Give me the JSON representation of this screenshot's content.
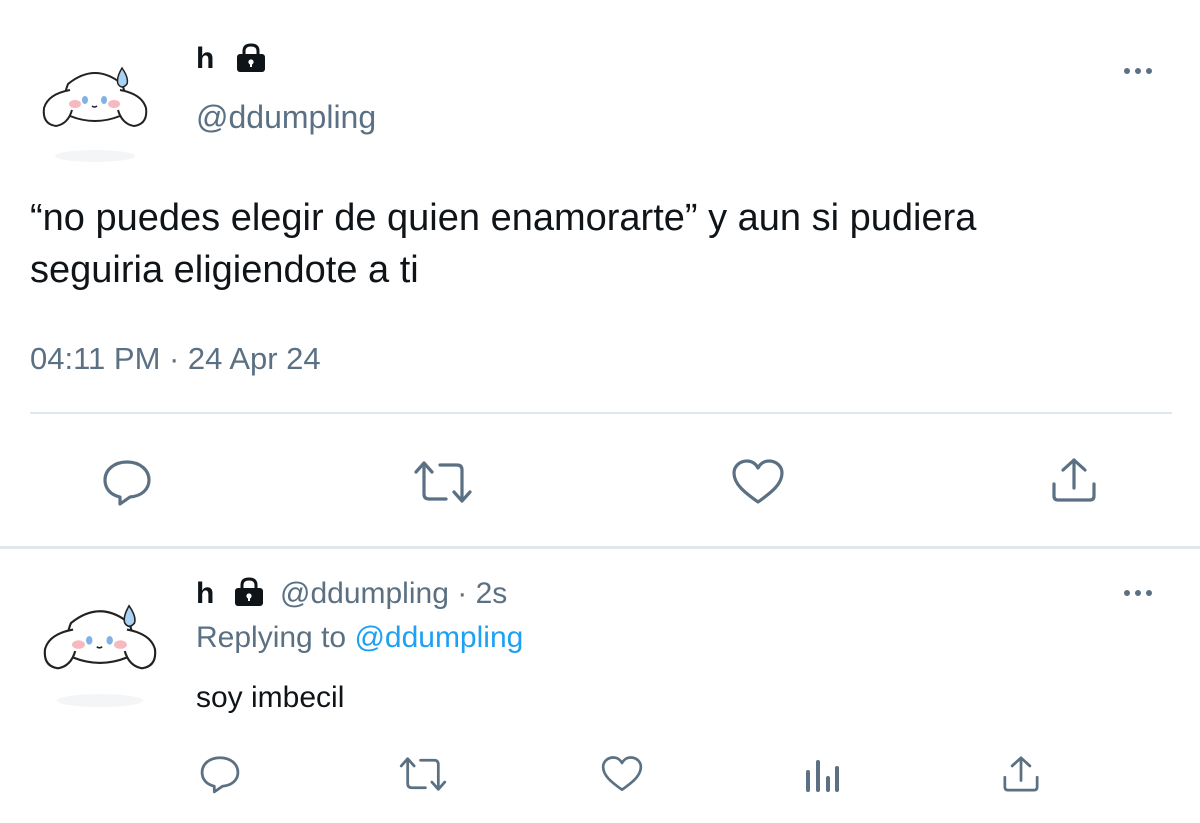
{
  "main_tweet": {
    "display_name": "h",
    "handle": "@ddumpling",
    "text": "“no puedes elegir de quien enamorarte” y aun si pudiera seguiria eligiendote a ti",
    "timestamp": "04:11 PM · 24 Apr 24",
    "actions": [
      "reply-icon",
      "retweet-icon",
      "like-icon",
      "share-icon"
    ]
  },
  "reply_tweet": {
    "display_name": "h",
    "handle": "@ddumpling",
    "separator": "·",
    "time_ago": "2s",
    "replying_prefix": "Replying to",
    "replying_handle": "@ddumpling",
    "text": "soy imbecil",
    "actions": [
      "reply-icon",
      "retweet-icon",
      "like-icon",
      "analytics-icon",
      "share-icon"
    ]
  },
  "colors": {
    "text": "#0f1419",
    "muted": "#5b7083",
    "link": "#1da1f2",
    "divider": "#e1e8ed"
  }
}
